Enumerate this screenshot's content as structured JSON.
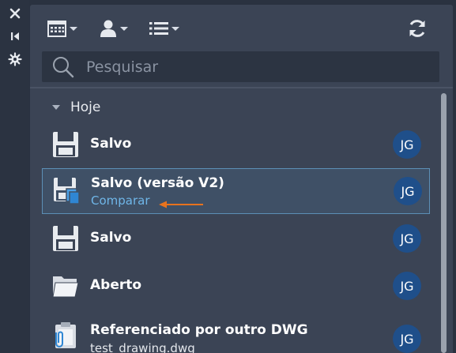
{
  "toolbar": {
    "calendar_icon": "calendar-icon",
    "user_icon": "user-icon",
    "list_icon": "list-icon",
    "refresh_icon": "refresh-icon"
  },
  "search": {
    "placeholder": "Pesquisar"
  },
  "group": {
    "label": "Hoje"
  },
  "items": [
    {
      "title": "Salvo",
      "icon": "floppy-disk-icon",
      "avatar": "JG"
    },
    {
      "title": "Salvo (versão V2)",
      "link": "Comparar",
      "icon": "floppy-disk-compare-icon",
      "avatar": "JG",
      "selected": true
    },
    {
      "title": "Salvo",
      "icon": "floppy-disk-icon",
      "avatar": "JG"
    },
    {
      "title": "Aberto",
      "icon": "open-folder-icon",
      "avatar": "JG"
    },
    {
      "title": "Referenciado por outro DWG",
      "subtitle": "test_drawing.dwg",
      "icon": "clipboard-paperclip-icon",
      "avatar": "JG"
    }
  ],
  "colors": {
    "background": "#3b4455",
    "selected_row": "#3f5066",
    "selected_border": "#5c8fb6",
    "link": "#6fb6e8",
    "avatar": "#1f4f8a",
    "annotation_arrow": "#e8731e"
  }
}
